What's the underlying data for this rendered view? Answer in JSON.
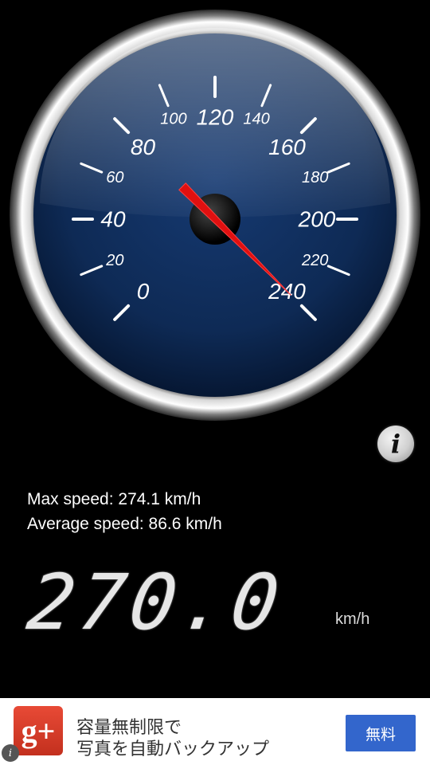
{
  "gauge": {
    "min": 0,
    "max": 240,
    "major_labels": [
      "0",
      "40",
      "80",
      "120",
      "160",
      "200",
      "240"
    ],
    "minor_labels": [
      "20",
      "60",
      "100",
      "140",
      "180",
      "220"
    ],
    "needle_value": 240,
    "face_color": "#0e2a55",
    "needle_color": "#e01010"
  },
  "info_button": {
    "icon": "info-icon",
    "glyph": "i"
  },
  "stats": {
    "max_speed": "Max speed: 274.1 km/h",
    "average_speed": "Average speed: 86.6 km/h"
  },
  "readout": {
    "value": "270.0",
    "unit": "km/h"
  },
  "ad": {
    "logo_glyph": "g+",
    "logo_icon": "google-plus-icon",
    "line1": "容量無制限で",
    "line2": "写真を自動バックアップ",
    "cta": "無料",
    "info_glyph": "i"
  }
}
